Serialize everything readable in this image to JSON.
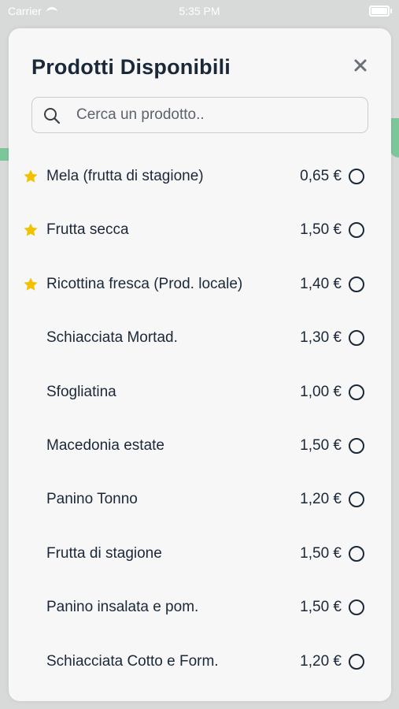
{
  "status_bar": {
    "carrier": "Carrier",
    "time": "5:35 PM",
    "battery_level": 1.0
  },
  "modal": {
    "title": "Prodotti Disponibili",
    "close_label": "×",
    "search": {
      "placeholder": "Cerca un prodotto..",
      "value": ""
    },
    "products": [
      {
        "name": "Mela (frutta di stagione)",
        "price": "0,65 €",
        "favorite": true,
        "selected": false
      },
      {
        "name": "Frutta secca",
        "price": "1,50 €",
        "favorite": true,
        "selected": false
      },
      {
        "name": "Ricottina fresca (Prod. locale)",
        "price": "1,40 €",
        "favorite": true,
        "selected": false
      },
      {
        "name": "Schiacciata Mortad.",
        "price": "1,30 €",
        "favorite": false,
        "selected": false
      },
      {
        "name": "Sfogliatina",
        "price": "1,00 €",
        "favorite": false,
        "selected": false
      },
      {
        "name": "Macedonia estate",
        "price": "1,50 €",
        "favorite": false,
        "selected": false
      },
      {
        "name": "Panino Tonno",
        "price": "1,20 €",
        "favorite": false,
        "selected": false
      },
      {
        "name": "Frutta di stagione",
        "price": "1,50 €",
        "favorite": false,
        "selected": false
      },
      {
        "name": "Panino insalata e pom.",
        "price": "1,50 €",
        "favorite": false,
        "selected": false
      },
      {
        "name": "Schiacciata Cotto e Form.",
        "price": "1,20 €",
        "favorite": false,
        "selected": false
      }
    ]
  },
  "colors": {
    "title_text": "#1b2838",
    "star": "#f2c200",
    "accent_green": "#7cc79a",
    "modal_background": "#f7f7f8"
  }
}
